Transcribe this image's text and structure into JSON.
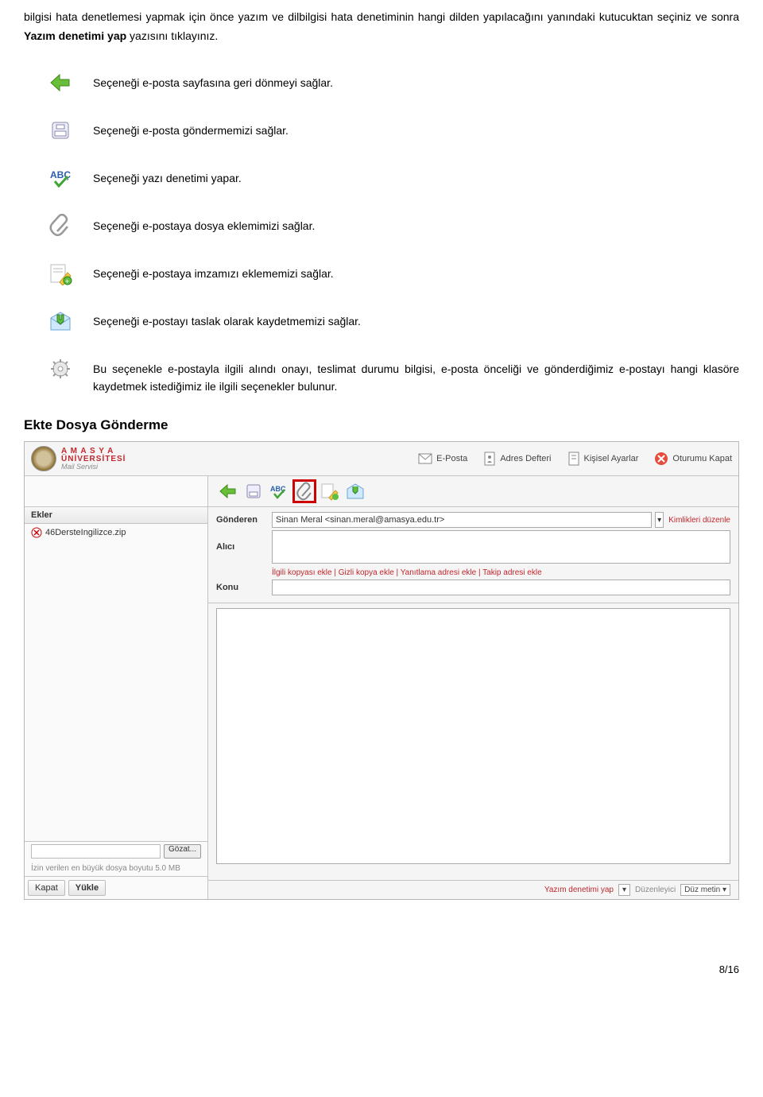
{
  "intro": {
    "part1": "bilgisi hata denetlemesi yapmak için önce yazım ve dilbilgisi hata denetiminin hangi dilden yapılacağını yanındaki kutucuktan seçiniz ve sonra ",
    "bold": "Yazım denetimi yap",
    "part2": " yazısını tıklayınız."
  },
  "features": [
    {
      "text": "Seçeneği e-posta sayfasına geri dönmeyi sağlar."
    },
    {
      "text": "Seçeneği e-posta göndermemizi sağlar."
    },
    {
      "text": "Seçeneği yazı denetimi yapar."
    },
    {
      "text": "Seçeneği e-postaya dosya eklemimizi sağlar."
    },
    {
      "text": "Seçeneği e-postaya imzamızı eklememizi sağlar."
    },
    {
      "text": "Seçeneği e-postayı taslak olarak kaydetmemizi sağlar."
    },
    {
      "text": "Bu seçenekle e-postayla ilgili alındı onayı, teslimat durumu bilgisi, e-posta önceliği ve gönderdiğimiz e-postayı hangi klasöre kaydetmek istediğimiz ile ilgili seçenekler bulunur."
    }
  ],
  "heading": "Ekte Dosya Gönderme",
  "screenshot": {
    "logo": {
      "l1": "A M A S Y A",
      "l2": "ÜNİVERSİTESİ",
      "l3": "Mail Servisi"
    },
    "topnav": {
      "eposta": "E-Posta",
      "adres": "Adres Defteri",
      "ayarlar": "Kişisel Ayarlar",
      "cikis": "Oturumu Kapat"
    },
    "left": {
      "header": "Ekler",
      "attachment": "46DersteIngilizce.zip",
      "gozat": "Gözat...",
      "hint": "İzin verilen en büyük dosya boyutu 5.0 MB",
      "kapat": "Kapat",
      "yukle": "Yükle"
    },
    "form": {
      "gonderen": "Gönderen",
      "gonderen_val": "Sinan Meral <sinan.meral@amasya.edu.tr>",
      "kimlik": "Kimlikleri düzenle",
      "alici": "Alıcı",
      "links": "İlgili kopyası ekle | Gizli kopya ekle | Yanıtlama adresi ekle | Takip adresi ekle",
      "konu": "Konu"
    },
    "bottom": {
      "yazim": "Yazım denetimi yap",
      "duzen": "Düzenleyici",
      "duz": "Düz metin"
    }
  },
  "page_number": "8/16"
}
